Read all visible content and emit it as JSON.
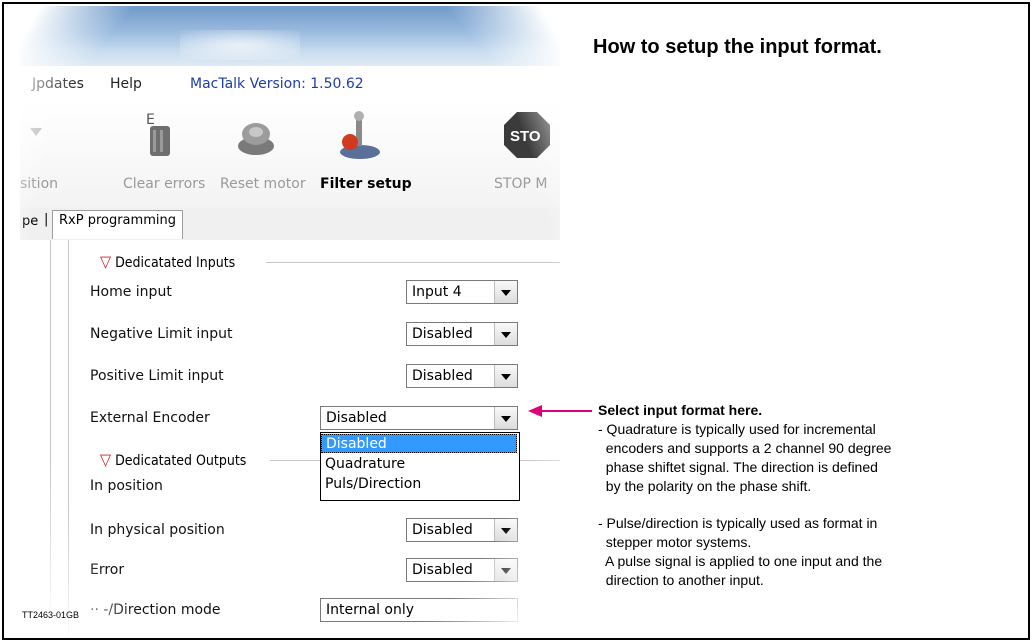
{
  "heading": "How to setup the input format.",
  "menu": {
    "item1": "Jpdates",
    "item2": "Help",
    "version": "MacTalk Version: 1.50.62"
  },
  "toolbar": {
    "items": [
      "sition",
      "Clear errors",
      "Reset motor",
      "Filter setup",
      "STOP M"
    ],
    "stop_sign": "STO"
  },
  "tabs": {
    "left": "pe",
    "selected": "RxP programming"
  },
  "inputs_group": "Dedicatated Inputs",
  "outputs_group": "Dedicatated Outputs",
  "rows": {
    "home": {
      "label": "Home input",
      "value": "Input 4"
    },
    "neg": {
      "label": "Negative Limit input",
      "value": "Disabled"
    },
    "pos": {
      "label": "Positive Limit input",
      "value": "Disabled"
    },
    "enc": {
      "label": "External Encoder",
      "value": "Disabled"
    },
    "inpos": {
      "label": "In position"
    },
    "phys": {
      "label": "In physical position",
      "value": "Disabled"
    },
    "err": {
      "label": "Error",
      "value": "Disabled"
    },
    "mode": {
      "label": "/Direction mode",
      "prefix": "·· -",
      "value": "Internal only"
    }
  },
  "dropdown_options": [
    "Disabled",
    "Quadrature",
    "Puls/Direction"
  ],
  "annotation": {
    "title": "Select input format here.",
    "quadrature": "- Quadrature is typically used for incremental\n  encoders and supports a 2 channel 90 degree\n  phase shiftet signal. The direction is defined\n  by the polarity on the phase shift.",
    "pulse": "- Pulse/direction is typically used as format in\n  stepper motor systems.\n  A pulse signal is applied to one input and the\n  direction to another input.",
    "arrow_color": "#e0007a"
  },
  "code": "TT2463-01GB"
}
